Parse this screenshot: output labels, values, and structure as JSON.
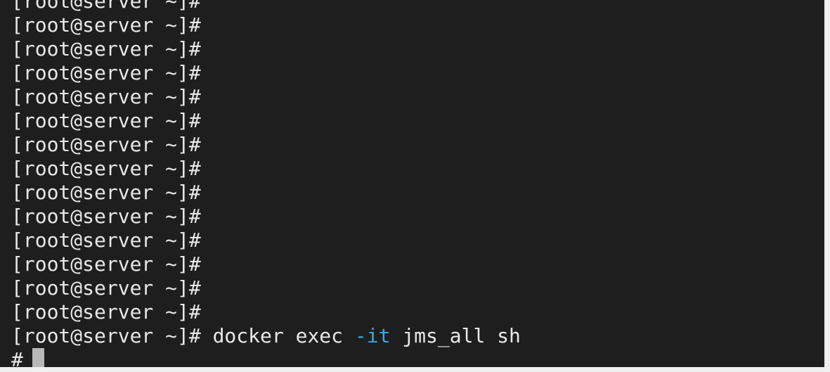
{
  "terminal": {
    "prompt": "[root@server ~]#",
    "history_lines": [
      "[root@server ~]#",
      "[root@server ~]#",
      "[root@server ~]#",
      "[root@server ~]#",
      "[root@server ~]#",
      "[root@server ~]#",
      "[root@server ~]#",
      "[root@server ~]#",
      "[root@server ~]#",
      "[root@server ~]#",
      "[root@server ~]#",
      "[root@server ~]#",
      "[root@server ~]#",
      "[root@server ~]#"
    ],
    "command": {
      "cmd": "docker exec",
      "flag": "-it",
      "args": "jms_all sh"
    },
    "shell_prompt": "#"
  },
  "colors": {
    "background": "#1e1e1e",
    "foreground": "#e8e8e8",
    "flag": "#3aa7e0",
    "cursor": "#b8b8b8"
  }
}
